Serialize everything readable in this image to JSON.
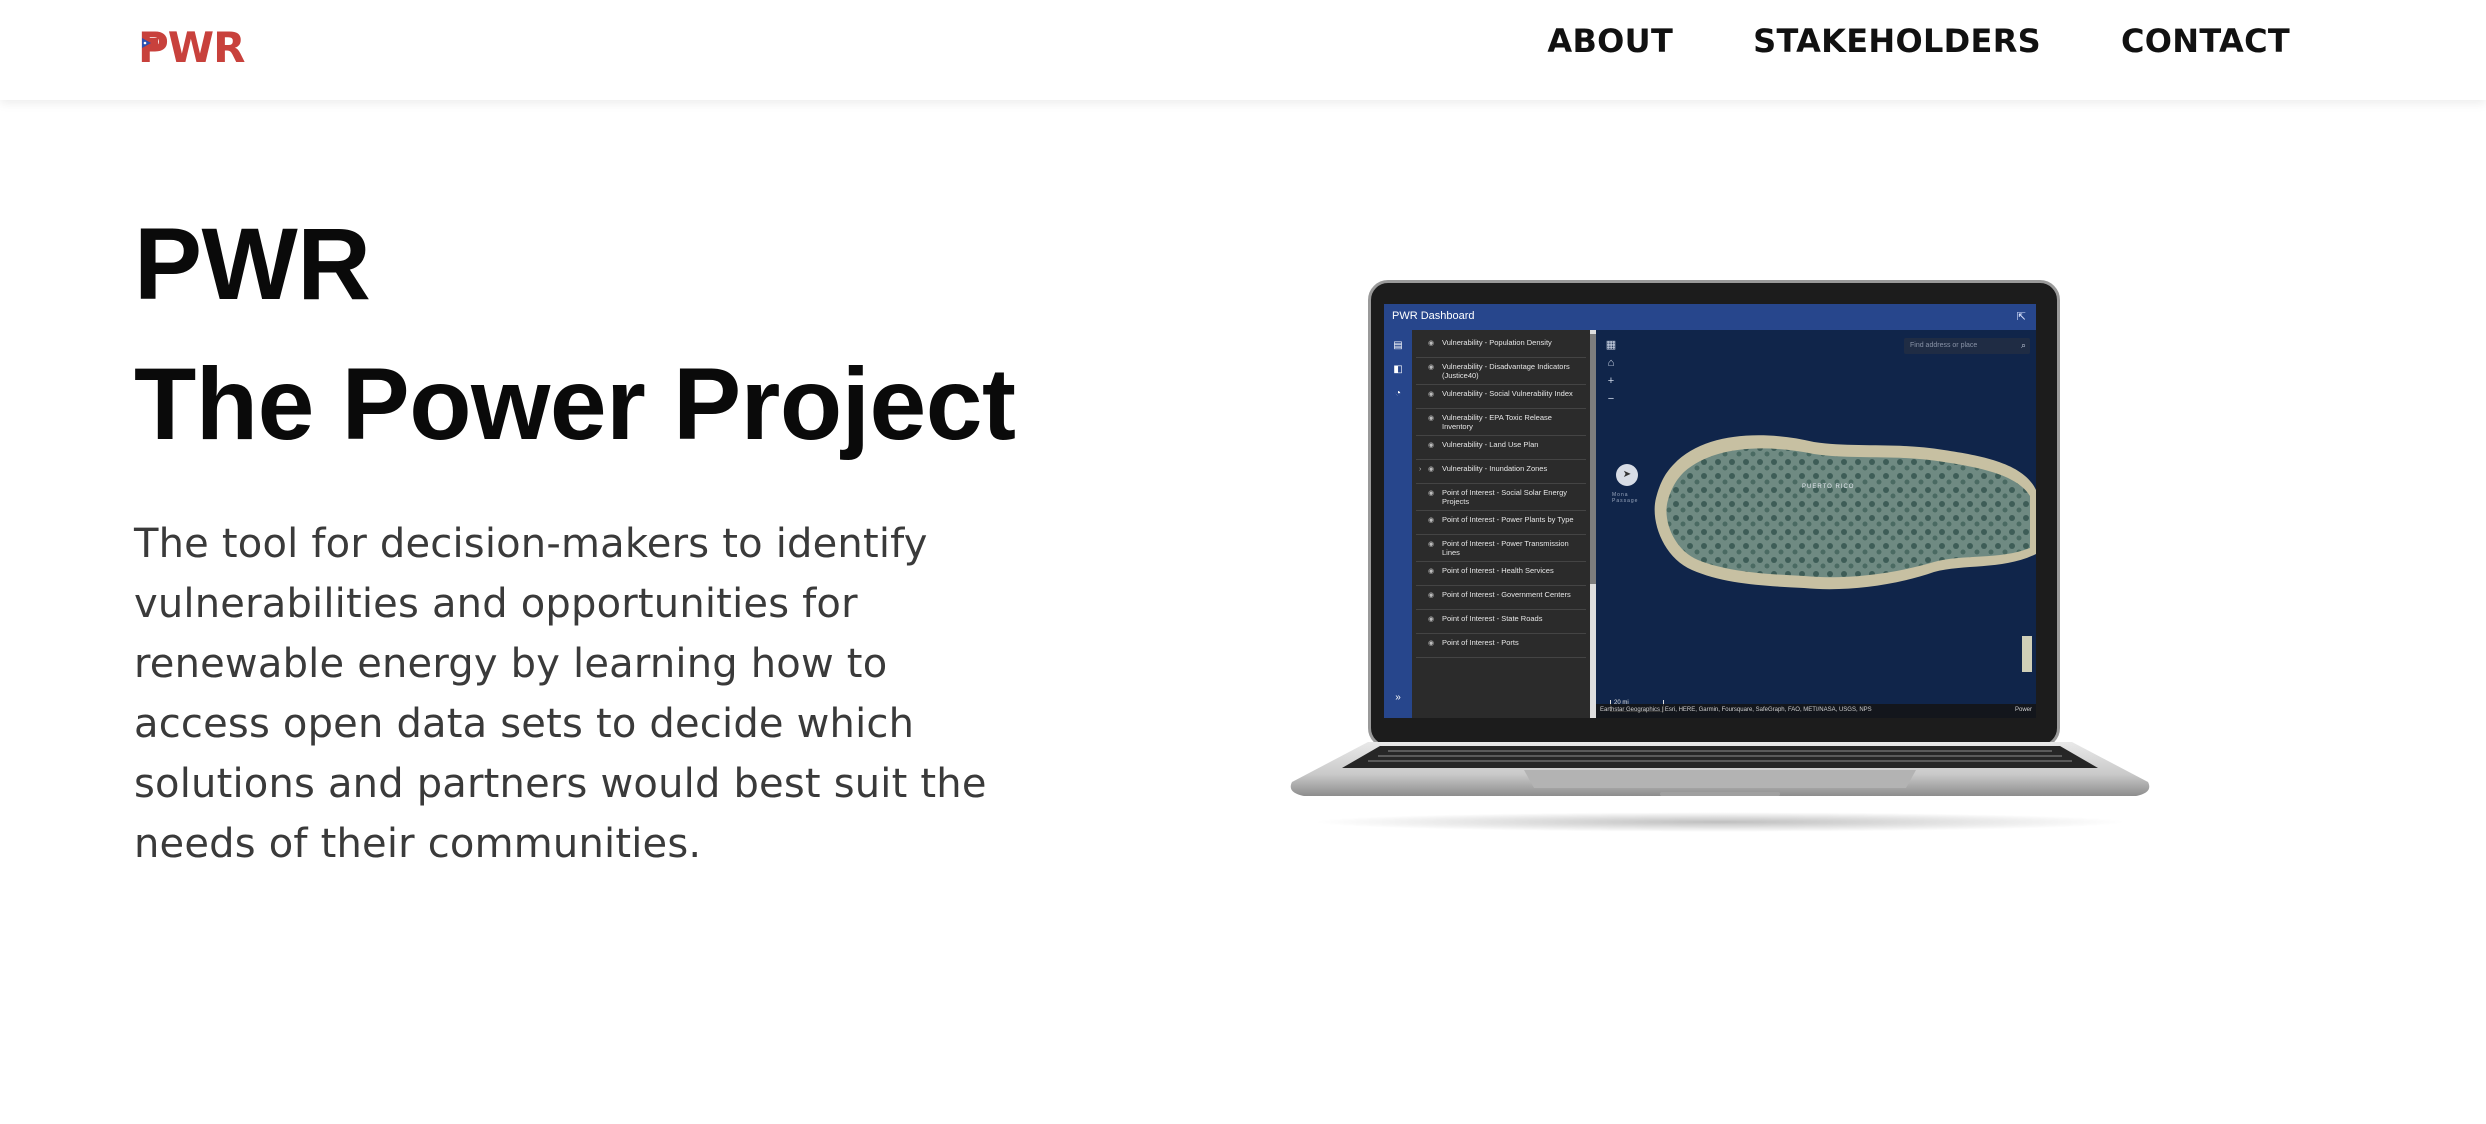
{
  "brand": {
    "logo_text": "PWR",
    "accent": "#c8413c",
    "flag_blue": "#2a4fb0"
  },
  "nav": {
    "links": [
      {
        "label": "ABOUT"
      },
      {
        "label": "STAKEHOLDERS"
      },
      {
        "label": "CONTACT"
      }
    ]
  },
  "hero": {
    "title_line1": "PWR",
    "title_line2": "The Power Project",
    "description": "The tool for decision-makers to identify vulnerabilities and opportunities for renewable energy by learning how to access open data sets to decide which solutions and partners would best suit the needs of their communities."
  },
  "laptop_screen": {
    "dashboard_title": "PWR Dashboard",
    "layers": [
      {
        "label": "Vulnerability - Population Density",
        "expandable": false
      },
      {
        "label": "Vulnerability - Disadvantage Indicators (Justice40)",
        "expandable": false
      },
      {
        "label": "Vulnerability - Social Vulnerability Index",
        "expandable": false
      },
      {
        "label": "Vulnerability - EPA Toxic Release Inventory",
        "expandable": false
      },
      {
        "label": "Vulnerability - Land Use Plan",
        "expandable": false
      },
      {
        "label": "Vulnerability - Inundation Zones",
        "expandable": true
      },
      {
        "label": "Point of Interest - Social Solar Energy Projects",
        "expandable": false
      },
      {
        "label": "Point of Interest - Power Plants by Type",
        "expandable": false
      },
      {
        "label": "Point of Interest - Power Transmission Lines",
        "expandable": false
      },
      {
        "label": "Point of Interest - Health Services",
        "expandable": false
      },
      {
        "label": "Point of Interest - Government Centers",
        "expandable": false
      },
      {
        "label": "Point of Interest - State Roads",
        "expandable": false
      },
      {
        "label": "Point of Interest - Ports",
        "expandable": false
      }
    ],
    "search_placeholder": "Find address or place",
    "map_label": "PUERTO RICO",
    "sea_label": "Mona Passage",
    "scale_text": "20 mi",
    "attribution": "Earthstar Geographics | Esri, HERE, Garmin, Foursquare, SafeGraph, FAO, METI/NASA, USGS, NPS",
    "attribution_right": "Power"
  }
}
